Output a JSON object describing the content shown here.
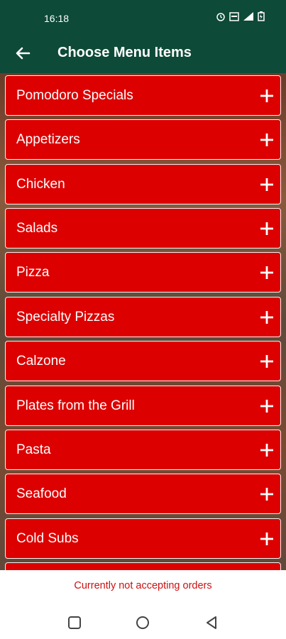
{
  "status_bar": {
    "time": "16:18"
  },
  "app_bar": {
    "title": "Choose Menu Items",
    "back_icon": "arrow-left-icon"
  },
  "menu": {
    "items": [
      {
        "label": "Pomodoro Specials"
      },
      {
        "label": "Appetizers"
      },
      {
        "label": "Chicken"
      },
      {
        "label": "Salads"
      },
      {
        "label": "Pizza"
      },
      {
        "label": "Specialty Pizzas"
      },
      {
        "label": "Calzone"
      },
      {
        "label": "Plates from the Grill"
      },
      {
        "label": "Pasta"
      },
      {
        "label": "Seafood"
      },
      {
        "label": "Cold Subs"
      }
    ],
    "expand_icon": "plus-icon",
    "item_color": "#dd0000"
  },
  "footer": {
    "message": "Currently not accepting orders",
    "message_color": "#cc1111"
  },
  "theme": {
    "appbar_color": "#0d4a37"
  },
  "nav": {
    "icons": [
      "square-icon",
      "circle-icon",
      "triangle-back-icon"
    ]
  }
}
